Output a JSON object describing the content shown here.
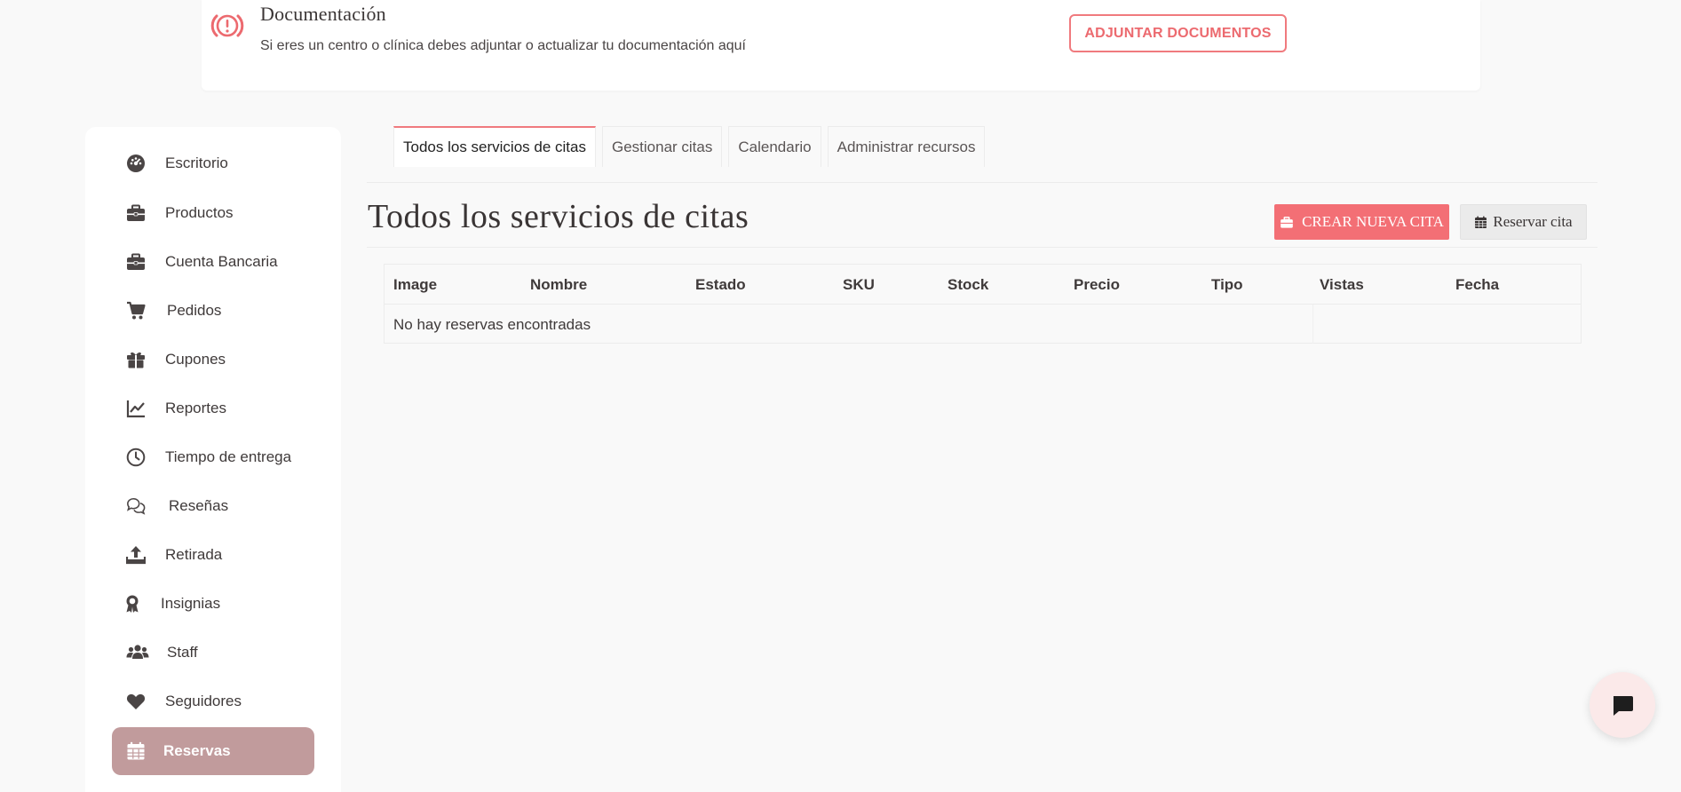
{
  "notice": {
    "title": "Documentación",
    "text": "Si eres un centro o clínica debes adjuntar o actualizar tu documentación aquí",
    "button": "ADJUNTAR DOCUMENTOS"
  },
  "sidebar": {
    "items": [
      {
        "label": "Escritorio",
        "icon": "dashboard-icon"
      },
      {
        "label": "Productos",
        "icon": "briefcase-icon"
      },
      {
        "label": "Cuenta Bancaria",
        "icon": "briefcase-icon"
      },
      {
        "label": "Pedidos",
        "icon": "cart-icon"
      },
      {
        "label": "Cupones",
        "icon": "gift-icon"
      },
      {
        "label": "Reportes",
        "icon": "line-chart-icon"
      },
      {
        "label": "Tiempo de entrega",
        "icon": "clock-icon"
      },
      {
        "label": "Reseñas",
        "icon": "comments-icon"
      },
      {
        "label": "Retirada",
        "icon": "upload-icon"
      },
      {
        "label": "Insignias",
        "icon": "award-icon"
      },
      {
        "label": "Staff",
        "icon": "users-icon"
      },
      {
        "label": "Seguidores",
        "icon": "heart-icon"
      },
      {
        "label": "Reservas",
        "icon": "calendar-icon",
        "active": true
      }
    ]
  },
  "tabs": [
    {
      "label": "Todos los servicios de citas",
      "active": true
    },
    {
      "label": "Gestionar citas"
    },
    {
      "label": "Calendario"
    },
    {
      "label": "Administrar recursos"
    }
  ],
  "main": {
    "title": "Todos los servicios de citas",
    "create_button": "CREAR NUEVA CITA",
    "reserve_button": "Reservar cita"
  },
  "table": {
    "columns": [
      "Image",
      "Nombre",
      "Estado",
      "SKU",
      "Stock",
      "Precio",
      "Tipo",
      "Vistas",
      "Fecha"
    ],
    "empty_message": "No hay reservas encontradas"
  },
  "colors": {
    "accent": "#f36f75",
    "sidebar_active": "#c19b9c",
    "background": "#f9f9f9"
  }
}
